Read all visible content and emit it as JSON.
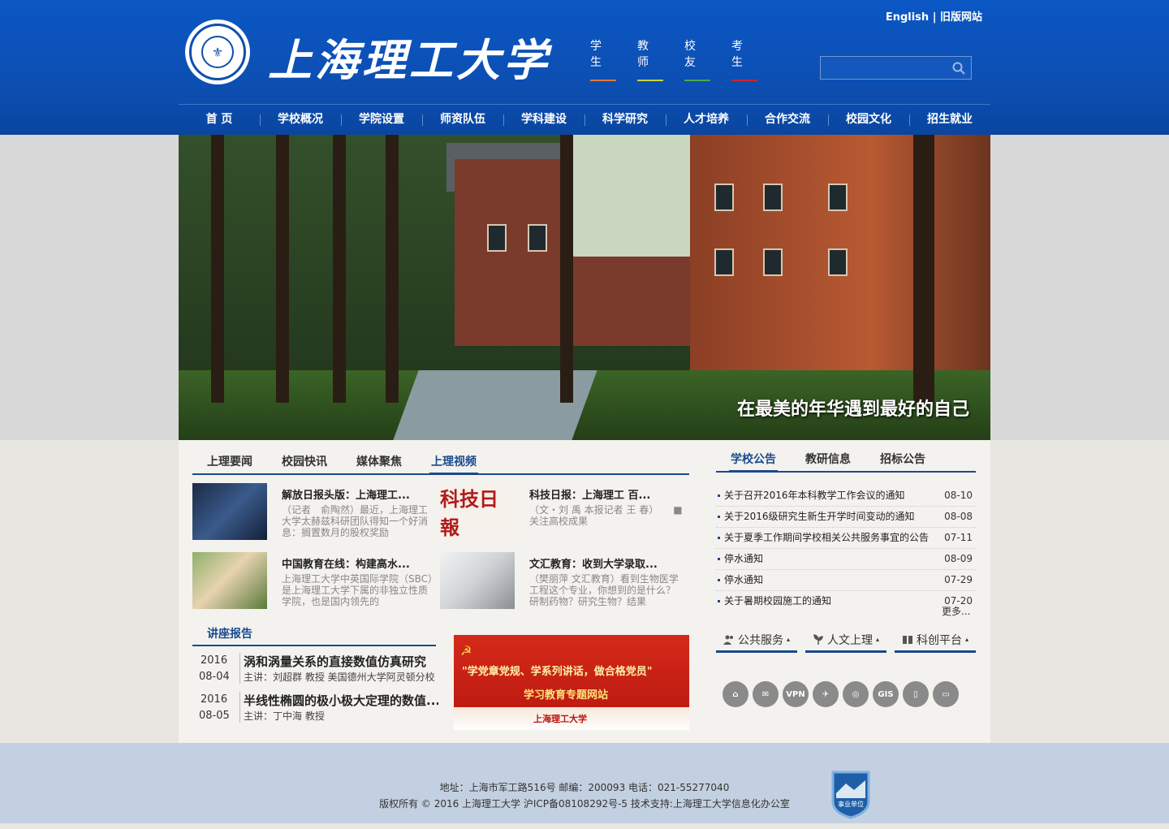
{
  "header": {
    "logo_text": "上海理工大学",
    "top_links": {
      "english": "English",
      "separator": " | ",
      "old_site": "旧版网站"
    },
    "audience": [
      {
        "label": "学生",
        "color": "#e07a3a"
      },
      {
        "label": "教师",
        "color": "#c9d43a"
      },
      {
        "label": "校友",
        "color": "#4ea84a"
      },
      {
        "label": "考生",
        "color": "#c8262e"
      }
    ],
    "search": {
      "placeholder": ""
    },
    "nav": [
      "首 页",
      "学校概况",
      "学院设置",
      "师资队伍",
      "学科建设",
      "科学研究",
      "人才培养",
      "合作交流",
      "校园文化",
      "招生就业"
    ]
  },
  "banner": {
    "caption": "在最美的年华遇到最好的自己"
  },
  "news": {
    "tabs": [
      "上理要闻",
      "校园快讯",
      "媒体聚焦",
      "上理视频"
    ],
    "active_tab": 3,
    "items": [
      {
        "title": "解放日报头版：上海理工...",
        "summary": "（记者　俞陶然）最近，上海理工大学太赫兹科研团队得知一个好消息：搁置数月的股权奖励"
      },
      {
        "title": "科技日报：上海理工 百...",
        "summary": "（文・刘 禹 本报记者 王 春）　　■关注高校成果"
      },
      {
        "title": "中国教育在线：构建高水...",
        "summary": "上海理工大学中英国际学院（SBC）是上海理工大学下属的非独立性质学院，也是国内领先的"
      },
      {
        "title": "文汇教育：收到大学录取...",
        "summary": "（樊丽萍 文汇教育）看到生物医学工程这个专业，你想到的是什么？研制药物？研究生物？结果"
      }
    ]
  },
  "lectures": {
    "heading": "讲座报告",
    "items": [
      {
        "year": "2016",
        "date": "08-04",
        "title": "涡和涡量关系的直接数值仿真研究",
        "speaker": "主讲：刘超群 教授 美国德州大学阿灵顿分校"
      },
      {
        "year": "2016",
        "date": "08-05",
        "title": "半线性椭圆的极小极大定理的数值...",
        "speaker": "主讲：丁中海 教授"
      }
    ]
  },
  "promo": {
    "line1": "\"学党章党规、学系列讲话，做合格党员\"",
    "line2": "学习教育专题网站",
    "brand": "上海理工大学"
  },
  "notices": {
    "tabs": [
      "学校公告",
      "教研信息",
      "招标公告"
    ],
    "active_tab": 0,
    "items": [
      {
        "text": "关于召开2016年本科教学工作会议的通知",
        "date": "08-10"
      },
      {
        "text": "关于2016级研究生新生开学时间变动的通知",
        "date": "08-08"
      },
      {
        "text": "关于夏季工作期间学校相关公共服务事宜的公告",
        "date": "07-11"
      },
      {
        "text": "停水通知",
        "date": "08-09"
      },
      {
        "text": "停水通知",
        "date": "07-29"
      },
      {
        "text": "关于暑期校园施工的通知",
        "date": "07-20"
      }
    ],
    "more": "更多..."
  },
  "services": [
    {
      "label": "公共服务",
      "icon": "people-icon"
    },
    {
      "label": "人文上理",
      "icon": "plant-icon"
    },
    {
      "label": "科创平台",
      "icon": "book-icon"
    }
  ],
  "quick_icons": [
    {
      "name": "home-icon",
      "text": "⌂"
    },
    {
      "name": "mail-icon",
      "text": "✉"
    },
    {
      "name": "vpn-icon",
      "text": "VPN"
    },
    {
      "name": "bird-icon",
      "text": "✈"
    },
    {
      "name": "weibo-icon",
      "text": "◎"
    },
    {
      "name": "gis-icon",
      "text": "GIS"
    },
    {
      "name": "phone-icon",
      "text": "▯"
    },
    {
      "name": "monitor-icon",
      "text": "▭"
    }
  ],
  "footer": {
    "address": "地址：上海市军工路516号 邮编：200093 电话：021-55277040",
    "copyright": "版权所有 © 2016 上海理工大学 沪ICP备08108292号-5 技术支持:上海理工大学信息化办公室",
    "badge": "事业单位"
  }
}
